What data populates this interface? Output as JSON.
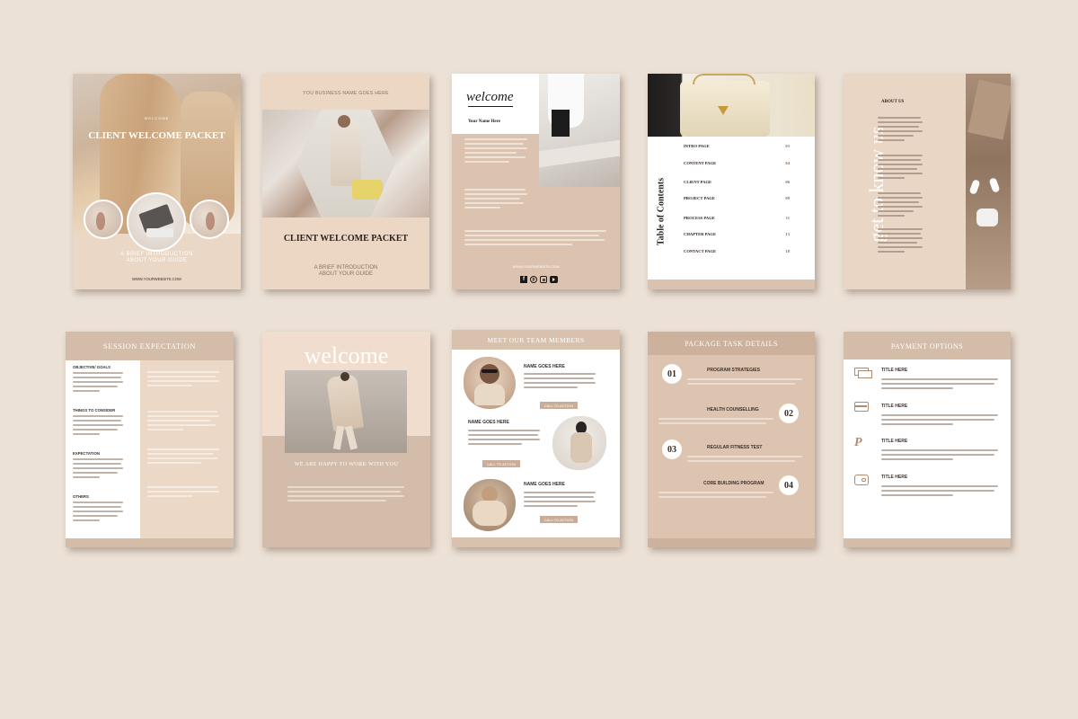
{
  "colors": {
    "background": "#ece1d6",
    "beige": "#ead6c4",
    "taupe": "#d3bca9",
    "dark": "#2b2320",
    "accent": "#c9ad98"
  },
  "pages": {
    "cover": {
      "small_label": "WELCOME",
      "title": "CLIENT WELCOME PACKET",
      "subtitle_1": "A BRIEF INTRODUCTION",
      "subtitle_2": "ABOUT YOUR GUIDE",
      "website": "WWW.YOURWEBSITE.COM"
    },
    "cover2": {
      "business": "YOU BUSINESS NAME GOES HERE",
      "title": "CLIENT WELCOME PACKET",
      "subtitle_1": "A BRIEF INTRODUCTION",
      "subtitle_2": "ABOUT YOUR GUIDE"
    },
    "welcome_note": {
      "script": "welcome",
      "name": "Your Name Here",
      "website": "WWW.YOURWEBSITE.COM",
      "social_icons": [
        "facebook-icon",
        "pinterest-icon",
        "instagram-icon",
        "youtube-icon"
      ]
    },
    "toc": {
      "title": "Table of Contents",
      "items": [
        {
          "label": "INTRO PAGE",
          "page": "03"
        },
        {
          "label": "CONTENT PAGE",
          "page": "04"
        },
        {
          "label": "CLIENT PAGE",
          "page": "06"
        },
        {
          "label": "PROJECT PAGE",
          "page": "09"
        },
        {
          "label": "PROCESS PAGE",
          "page": "11"
        },
        {
          "label": "CHAPTER PAGE",
          "page": "13"
        },
        {
          "label": "CONTACT PAGE",
          "page": "18"
        }
      ]
    },
    "about": {
      "heading": "ABOUT US",
      "vertical": "get to know us"
    },
    "session": {
      "title": "SESSION EXPECTATION",
      "sections": [
        "OBJECTIVE/ GOALS",
        "THINGS TO CONSIDER",
        "EXPECTATION",
        "OTHERS"
      ]
    },
    "welcome_page": {
      "title": "welcome",
      "tagline": "WE ARE HAPPY TO WORK WITH YOU"
    },
    "team": {
      "title": "MEET OUR TEAM MEMBERS",
      "members": [
        {
          "name": "NAME GOES HERE",
          "button": "CALL TO ACTION"
        },
        {
          "name": "NAME GOES HERE",
          "button": "CALL TO ACTION"
        },
        {
          "name": "NAME GOES HERE",
          "button": "CALL TO ACTION"
        }
      ]
    },
    "package": {
      "title": "PACKAGE  TASK DETAILS",
      "items": [
        {
          "num": "01",
          "label": "PROGRAM STRATEGIES"
        },
        {
          "num": "02",
          "label": "HEALTH COUNSELLING"
        },
        {
          "num": "03",
          "label": "REGULAR  FITNESS TEST"
        },
        {
          "num": "04",
          "label": "CORE BUILDING PROGRAM"
        }
      ]
    },
    "payment": {
      "title": "PAYMENT OPTIONS",
      "options": [
        {
          "icon": "cash-icon",
          "label": "TITLE HERE"
        },
        {
          "icon": "credit-card-icon",
          "label": "TITLE HERE"
        },
        {
          "icon": "paypal-icon",
          "label": "TITLE HERE"
        },
        {
          "icon": "wallet-icon",
          "label": "TITLE HERE"
        }
      ]
    }
  }
}
